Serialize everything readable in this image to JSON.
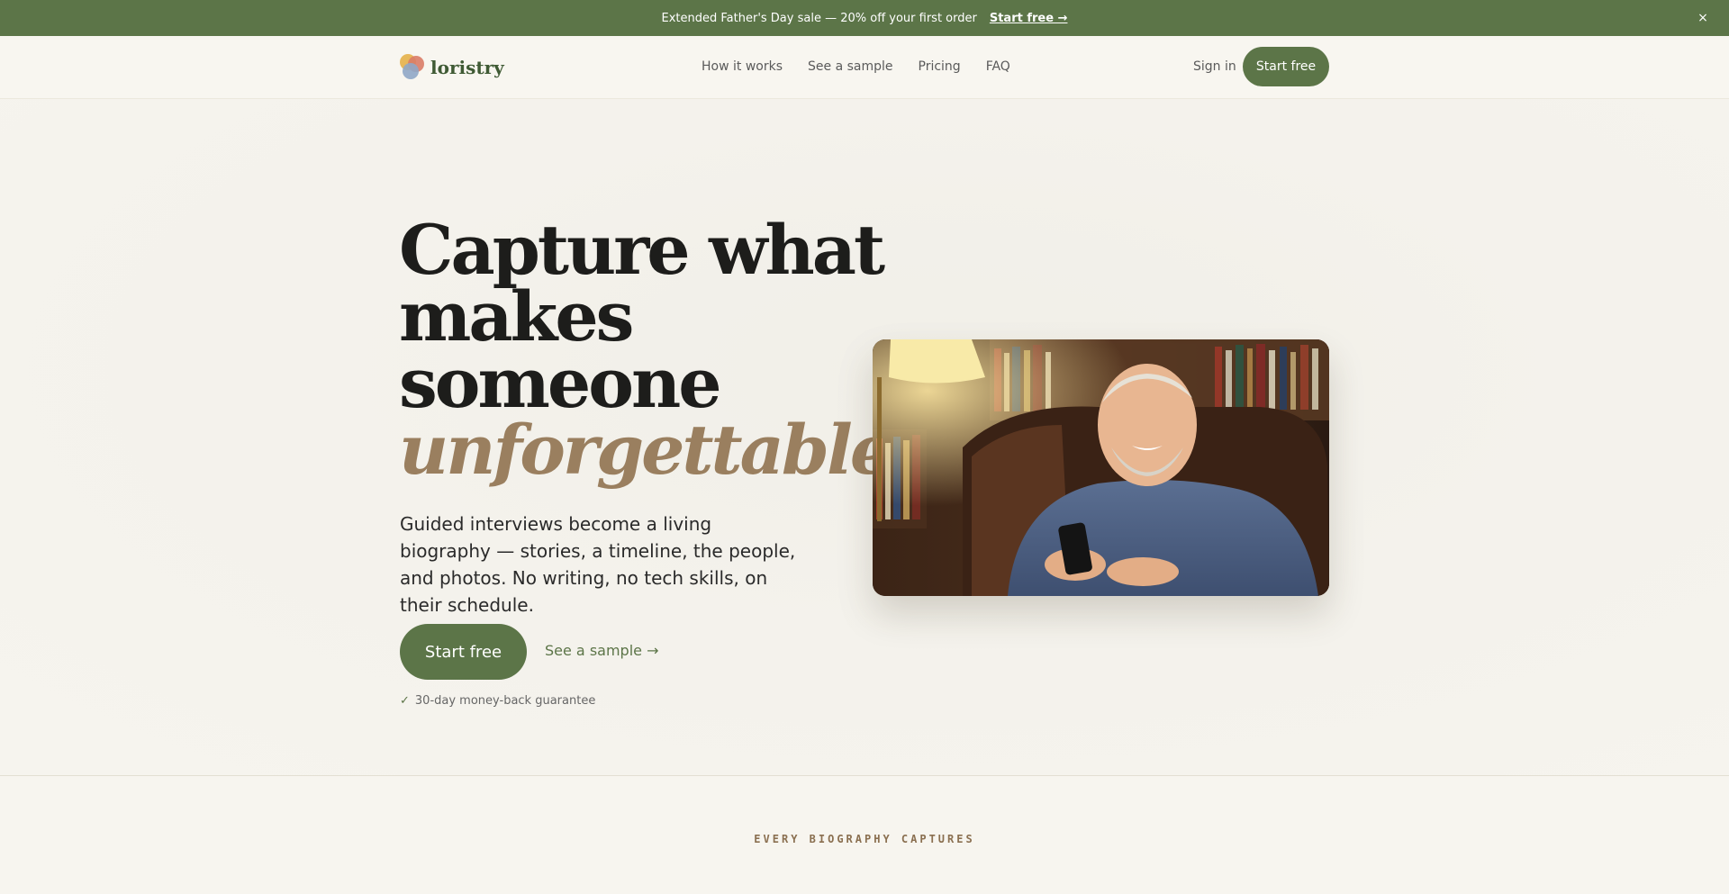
{
  "announcement": {
    "text": "Extended Father's Day sale — 20% off your first order",
    "link_label": "Start free →",
    "close_label": "×"
  },
  "header": {
    "logo_text": "loristry",
    "nav": [
      {
        "label": "How it works"
      },
      {
        "label": "See a sample"
      },
      {
        "label": "Pricing"
      },
      {
        "label": "FAQ"
      }
    ],
    "signin_label": "Sign in",
    "cta_label": "Start free"
  },
  "hero": {
    "headline_lines": [
      "Capture what",
      "makes",
      "someone"
    ],
    "headline_em": "unforgettable.",
    "subtext": "Guided interviews become a living biography — stories, a timeline, the people, and photos. No writing, no tech skills, on their schedule.",
    "cta_label": "Start free",
    "sample_label": "See a sample →",
    "guarantee_check": "✓",
    "guarantee_text": "30-day money-back guarantee"
  },
  "section": {
    "label": "EVERY BIOGRAPHY CAPTURES"
  },
  "colors": {
    "brand_green": "#5c7548",
    "accent_tan": "#9a7f5f",
    "background": "#f7f5ef"
  },
  "icons": {
    "close": "close-icon",
    "arrow": "arrow-right-icon",
    "check": "check-icon"
  }
}
